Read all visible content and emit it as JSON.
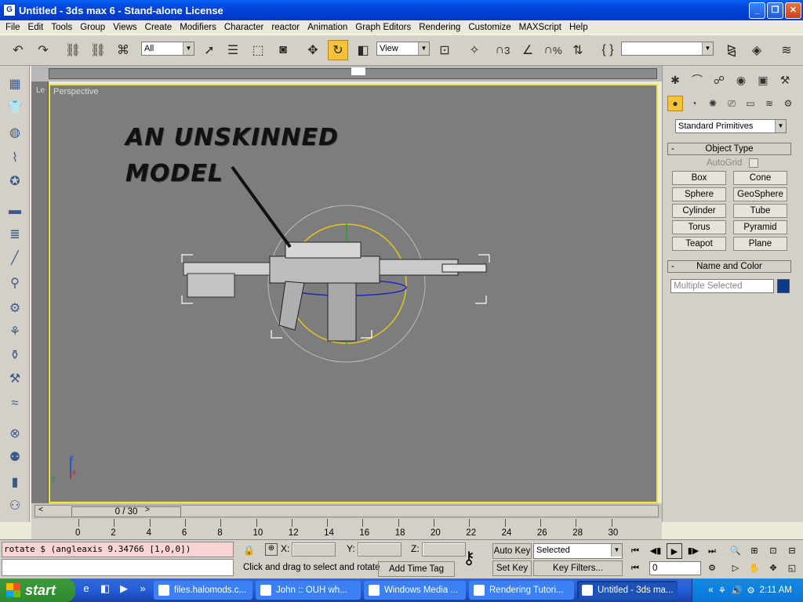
{
  "window": {
    "title": "Untitled - 3ds max 6 - Stand-alone License",
    "icon": "G"
  },
  "menu": [
    "File",
    "Edit",
    "Tools",
    "Group",
    "Views",
    "Create",
    "Modifiers",
    "Character",
    "reactor",
    "Animation",
    "Graph Editors",
    "Rendering",
    "Customize",
    "MAXScript",
    "Help"
  ],
  "toolbar": {
    "selection_filter": "All",
    "ref_coord": "View",
    "named_selection": "",
    "snap_label": "3",
    "percent_label": "%"
  },
  "viewport": {
    "label": "Perspective",
    "side_label": "Le",
    "annotation_line1": "AN UNSKINNED",
    "annotation_line2": "MODEL",
    "axis_z": "z",
    "axis_x": "x",
    "axis_y": "y"
  },
  "command_panel": {
    "category": "Standard Primitives",
    "object_type_header": "Object Type",
    "autogrid": "AutoGrid",
    "buttons": [
      "Box",
      "Cone",
      "Sphere",
      "GeoSphere",
      "Cylinder",
      "Tube",
      "Torus",
      "Pyramid",
      "Teapot",
      "Plane"
    ],
    "name_color_header": "Name and Color",
    "name_value": "Multiple Selected",
    "object_color": "#0a3a8c"
  },
  "timeline": {
    "slider": "0 / 30",
    "ticks": [
      "0",
      "2",
      "4",
      "6",
      "8",
      "10",
      "12",
      "14",
      "16",
      "18",
      "20",
      "22",
      "24",
      "26",
      "28",
      "30"
    ]
  },
  "status": {
    "maxscript_output": "rotate $ (angleaxis 9.34766 [1,0,0])",
    "x_label": "X:",
    "y_label": "Y:",
    "z_label": "Z:",
    "prompt": "Click and drag to select and rotate",
    "add_time_tag": "Add Time Tag",
    "auto_key": "Auto Key",
    "set_key": "Set Key",
    "key_mode": "Selected",
    "key_filters": "Key Filters...",
    "frame": "0"
  },
  "taskbar": {
    "start": "start",
    "tasks": [
      "files.halomods.c...",
      "John :: OUH wh...",
      "Windows Media ...",
      "Rendering Tutori...",
      "Untitled - 3ds ma..."
    ],
    "clock": "2:11 AM"
  }
}
